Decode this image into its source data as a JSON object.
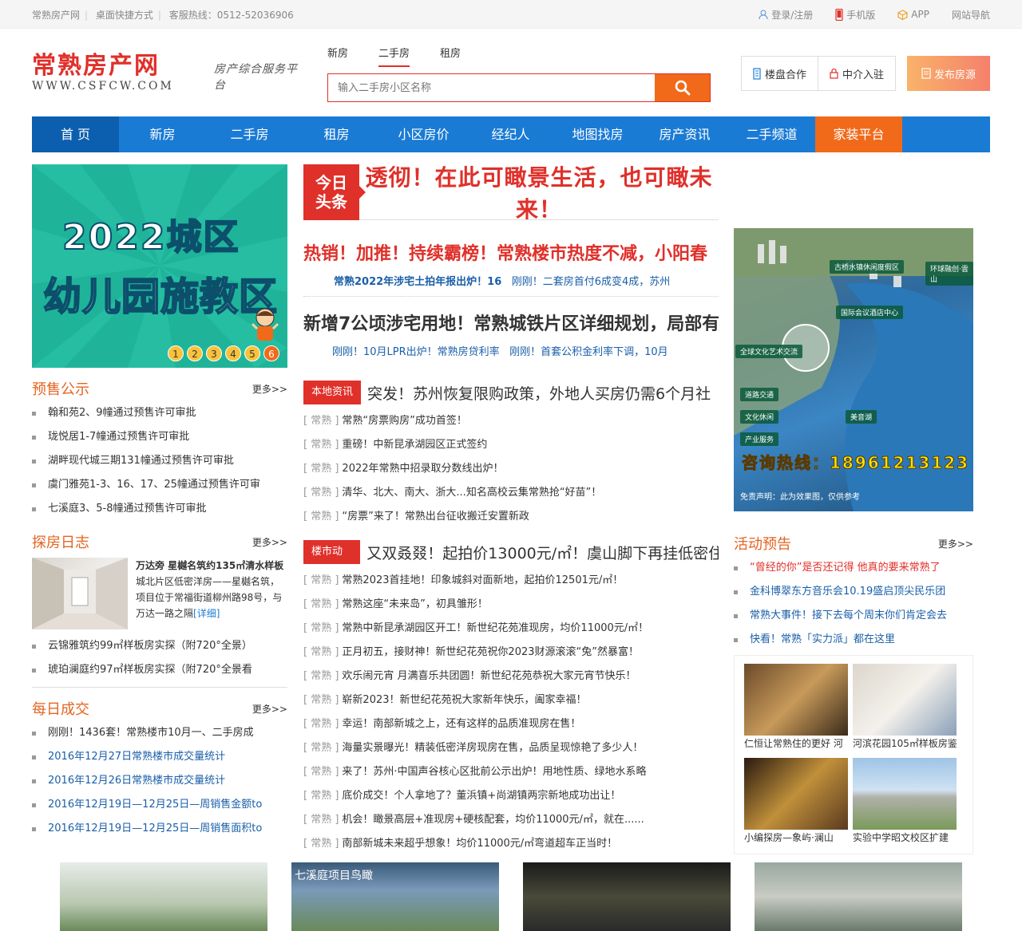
{
  "topbar": {
    "site": "常熟房产网",
    "shortcut": "桌面快捷方式",
    "hotline": "客服热线：0512-52036906",
    "login": "登录/注册",
    "mobile": "手机版",
    "app": "APP",
    "sitenav": "网站导航"
  },
  "logo": {
    "main": "常熟房产网",
    "url": "WWW.CSFCW.COM",
    "slogan": "房产综合服务平台"
  },
  "search": {
    "tabs": [
      "新房",
      "二手房",
      "租房"
    ],
    "active_tab": "二手房",
    "placeholder": "输入二手房小区名称"
  },
  "header_buttons": {
    "coop": "楼盘合作",
    "agent": "中介入驻",
    "publish": "发布房源"
  },
  "nav": [
    "首 页",
    "新房",
    "二手房",
    "租房",
    "小区房价",
    "经纪人",
    "地图找房",
    "房产资讯",
    "二手频道",
    "家装平台"
  ],
  "banner_left": {
    "line1": "2022城区",
    "line2": "幼儿园施教区",
    "dots": [
      "1",
      "2",
      "3",
      "4",
      "5",
      "6"
    ],
    "active_dot": "6"
  },
  "presale": {
    "title": "预售公示",
    "more": "更多>>",
    "items": [
      "翰和苑2、9幢通过预售许可审批",
      "珑悦居1-7幢通过预售许可审批",
      "湖畔现代城三期131幢通过预售许可审批",
      "虞门雅苑1-3、16、17、25幢通过预售许可审",
      "七溪庭3、5-8幢通过预售许可审批"
    ]
  },
  "tanfang": {
    "title": "探房日志",
    "more": "更多>>",
    "feature_title": "万达旁 星樾名筑约135㎡清水样板",
    "feature_desc": "城北片区低密洋房——星樾名筑，项目位于常福街道柳州路98号，与万达一路之隔",
    "feature_link": "[详细]",
    "items": [
      "云锦雅筑约99㎡样板房实探（附720°全景）",
      "琥珀澜庭约97㎡样板房实探（附720°全景看"
    ]
  },
  "daily": {
    "title": "每日成交",
    "more": "更多>>",
    "items": [
      "刚刚！1436套！常熟楼市10月一、二手房成",
      "2016年12月27日常熟楼市成交量统计",
      "2016年12月26日常熟楼市成交量统计",
      "2016年12月19日—12月25日—周销售金额to",
      "2016年12月19日—12月25日—周销售面积to"
    ]
  },
  "headline": {
    "tag_line1": "今日",
    "tag_line2": "头条",
    "title": "透彻！在此可瞰景生活，也可瞰未来！",
    "big1": "热销！加推！持续霸榜！常熟楼市热度不减，小阳春",
    "sub1a": "常熟2022年涉宅土拍年报出炉！16",
    "sub1b": "刚刚！二套房首付6成变4成，苏州",
    "big2": "新增7公顷涉宅用地！常熟城铁片区详细规划，局部有",
    "sub2a": "刚刚！10月LPR出炉！常熟房贷利率",
    "sub2b": "刚刚！首套公积金利率下调，10月"
  },
  "local_news": {
    "tag": "本地资讯",
    "title": "突发！苏州恢复限购政策，外地人买房仍需6个月社",
    "src": "[ 常熟 ]",
    "items": [
      "常熟“房票购房”成功首签！",
      "重磅！中新昆承湖园区正式签约",
      "2022年常熟中招录取分数线出炉！",
      "清华、北大、南大、浙大...知名高校云集常熟抢“好苗”！",
      "“房票”来了！常熟出台征收搬迁安置新政"
    ]
  },
  "market_news": {
    "tag": "楼市动态",
    "title": "又双叒叕！起拍价13000元/㎡！虞山脚下再挂低密住",
    "src": "[ 常熟 ]",
    "items": [
      "常熟2023首挂地！印象城斜对面新地，起拍价12501元/㎡！",
      "常熟这座“未来岛”，初具雏形！",
      "常熟中新昆承湖园区开工！新世纪花苑准现房，均价11000元/㎡！",
      "正月初五，接财神！新世纪花苑祝你2023财源滚滚“兔”然暴富！",
      "欢乐闹元宵 月满喜乐共团圆！新世纪花苑恭祝大家元宵节快乐！",
      "崭新2023！新世纪花苑祝大家新年快乐，阖家幸福！",
      "幸运！南部新城之上，还有这样的品质准现房在售！",
      "海量实景曝光！精装低密洋房现房在售，品质呈现惊艳了多少人！",
      "来了！苏州·中国声谷核心区批前公示出炉！用地性质、绿地水系略",
      "底价成交！个人拿地了？董浜镇+尚湖镇两宗新地成功出让！",
      "机会！瞰景高层+准现房+硬核配套，均价11000元/㎡，就在......",
      "南部新城未来超乎想象！均价11000元/㎡弯道超车正当时！"
    ]
  },
  "banner_right": {
    "hotline": "咨询热线：18961213123",
    "note": "免责声明：此为效果图，仅供参考",
    "labels": [
      "古桥水镇休闲度假区",
      "环球融创·雲山",
      "国际会议酒店中心",
      "全球文化艺术交流",
      "道路交通",
      "文化休闲",
      "产业服务",
      "美音湖"
    ]
  },
  "events": {
    "title": "活动预告",
    "more": "更多>>",
    "items": [
      "“曾经的你”是否还记得 他真的要来常熟了",
      "金科博翠东方音乐会10.19盛启顶尖民乐团",
      "常熟大事件！接下去每个周末你们肯定会去",
      "快看！常熟「实力派」都在这里"
    ]
  },
  "gallery": [
    "仁恒让常熟住的更好 河",
    "河滨花园105㎡样板房鉴",
    "小编探房—象屿·澜山",
    "实验中学昭文校区扩建"
  ],
  "bottom_captions": [
    "七溪庭项目鸟瞰"
  ],
  "colors": {
    "brand_red": "#e0302a",
    "nav_blue": "#1a7bd5",
    "accent_orange": "#f06a1a",
    "link_blue": "#1a5fa8"
  }
}
